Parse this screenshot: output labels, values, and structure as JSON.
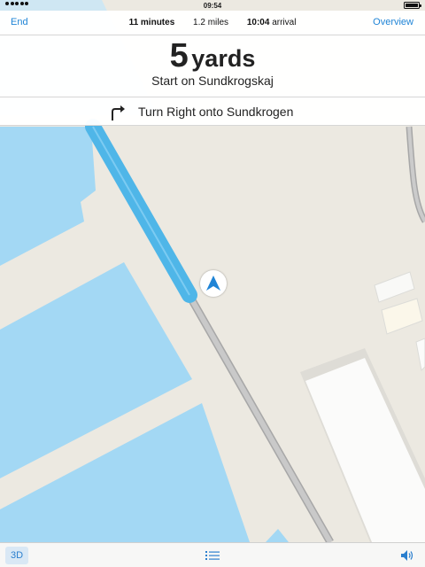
{
  "status_bar": {
    "time": "09:54"
  },
  "trip": {
    "end_label": "End",
    "overview_label": "Overview",
    "duration": "11 minutes",
    "distance": "1.2 miles",
    "arrival_time": "10:04",
    "arrival_label": "arrival"
  },
  "guidance": {
    "distance_value": "5",
    "distance_unit": "yards",
    "instruction": "Start on Sundkrogskaj"
  },
  "next_step": {
    "icon": "turn-right-icon",
    "label": "Turn Right onto Sundkrogen"
  },
  "bottom_bar": {
    "view_label": "3D",
    "list_icon": "list-icon",
    "sound_icon": "speaker-icon"
  },
  "colors": {
    "accent": "#1f84d6",
    "route": "#4fb6e8",
    "water": "#a3d8f4",
    "land": "#ece9e1"
  }
}
